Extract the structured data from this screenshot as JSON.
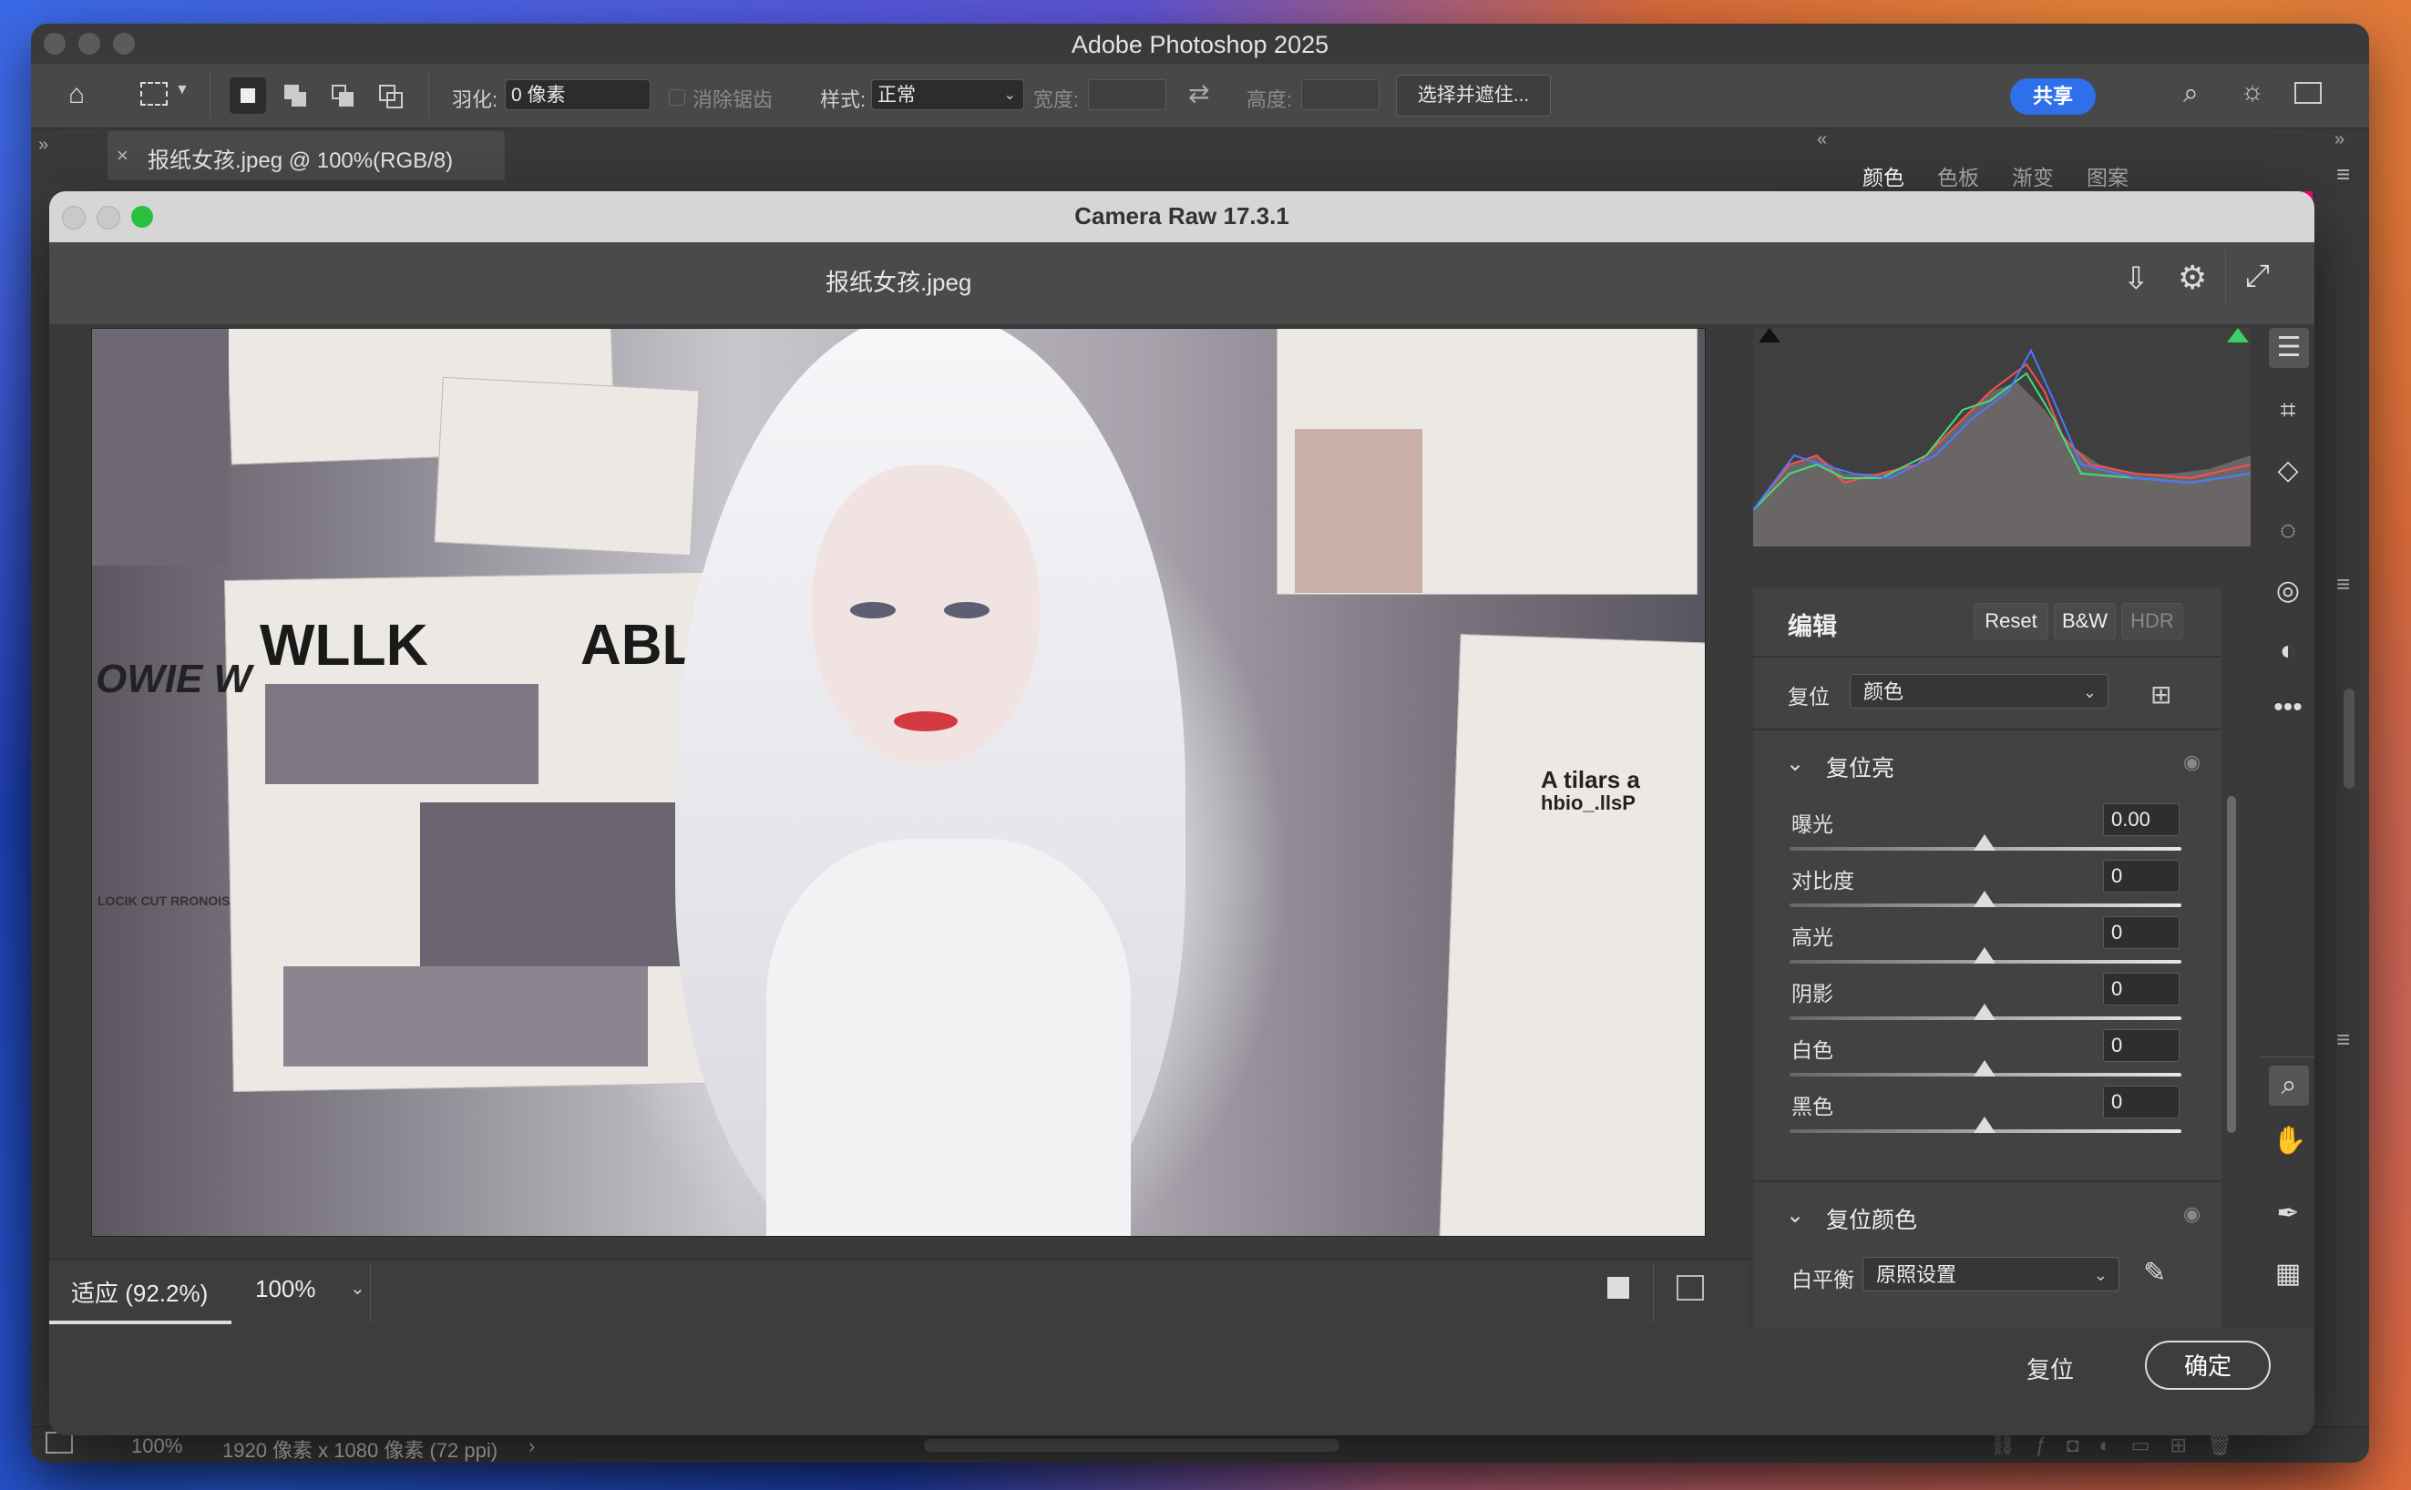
{
  "photoshop": {
    "app_title": "Adobe Photoshop 2025",
    "options": {
      "feather_label": "羽化:",
      "feather_value": "0 像素",
      "antialias_label": "消除锯齿",
      "style_label": "样式:",
      "style_value": "正常",
      "width_label": "宽度:",
      "height_label": "高度:",
      "select_mask_label": "选择并遮住...",
      "share_label": "共享"
    },
    "doc_tab": "报纸女孩.jpeg @ 100%(RGB/8)",
    "panel_tabs": [
      "颜色",
      "色板",
      "渐变",
      "图案"
    ],
    "status": {
      "zoom": "100%",
      "size": "1920 像素 x 1080 像素 (72 ppi)"
    }
  },
  "camera_raw": {
    "title": "Camera Raw 17.3.1",
    "filename": "报纸女孩.jpeg",
    "photo_text": {
      "headline_left": "WLLK",
      "headline_right": "ABL BFIAER",
      "side_left": "OWIE W",
      "side_right": "A tilars a",
      "side_right2": "hbio_.llsP",
      "small_caption": "LOCIK CUT RRONOIS"
    },
    "bottom": {
      "zoom_fit": "适应 (92.2%)",
      "zoom_value": "100%"
    },
    "footer": {
      "reset": "复位",
      "ok": "确定"
    },
    "edit": {
      "title": "编辑",
      "reset_btn": "Reset",
      "bw_btn": "B&W",
      "hdr_btn": "HDR",
      "profile_label": "复位",
      "profile_value": "颜色",
      "light_section": "复位亮",
      "sliders": [
        {
          "label": "曝光",
          "value": "0.00"
        },
        {
          "label": "对比度",
          "value": "0"
        },
        {
          "label": "高光",
          "value": "0"
        },
        {
          "label": "阴影",
          "value": "0"
        },
        {
          "label": "白色",
          "value": "0"
        },
        {
          "label": "黑色",
          "value": "0"
        }
      ],
      "color_section": "复位颜色",
      "wb_label": "白平衡",
      "wb_value": "原照设置"
    }
  }
}
